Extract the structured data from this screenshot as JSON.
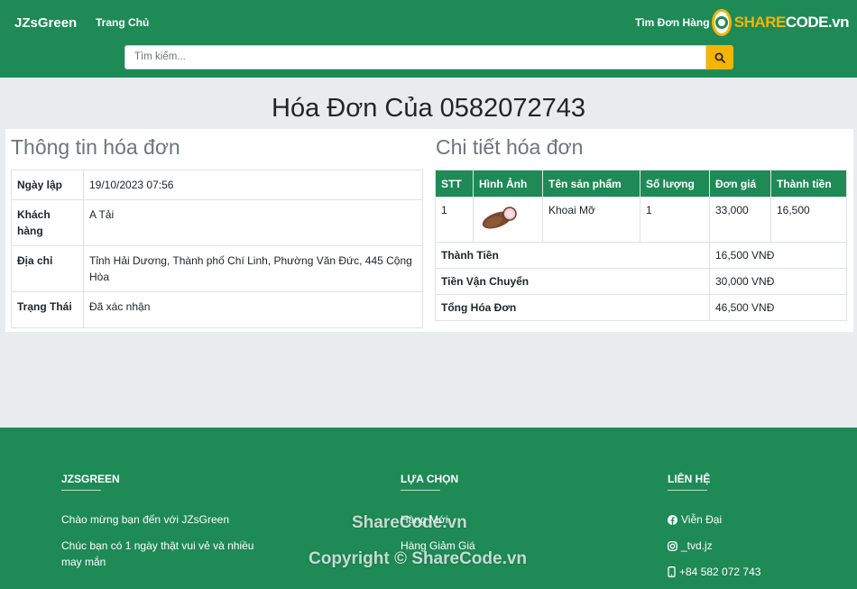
{
  "header": {
    "brand": "JZsGreen",
    "nav_home": "Trang Chủ",
    "nav_orders": "Tìm Đơn Hàng",
    "logo_text_a": "SHARE",
    "logo_text_b": "CODE.vn",
    "search_placeholder": "Tìm kiếm...",
    "search_icon": "search-icon"
  },
  "page": {
    "title": "Hóa Đơn Của 0582072743"
  },
  "invoice_info": {
    "title": "Thông tin hóa đơn",
    "rows": [
      {
        "label": "Ngày lập",
        "value": "19/10/2023 07:56"
      },
      {
        "label": "Khách hàng",
        "value": "A Tải"
      },
      {
        "label": "Địa chỉ",
        "value": "Tỉnh Hải Dương, Thành phố Chí Linh, Phường Văn Đức, 445 Cộng Hòa"
      },
      {
        "label": "Trạng Thái",
        "value": "Đã xác nhận"
      }
    ]
  },
  "invoice_detail": {
    "title": "Chi tiết hóa đơn",
    "columns": [
      "STT",
      "Hình Ảnh",
      "Tên sản phẩm",
      "Số lượng",
      "Đơn giá",
      "Thành tiền"
    ],
    "items": [
      {
        "stt": "1",
        "image": "cassava-image",
        "name": "Khoai Mỡ",
        "qty": "1",
        "price": "33,000",
        "total": "16,500"
      }
    ],
    "summary": [
      {
        "label": "Thành Tiền",
        "value": "16,500 VNĐ"
      },
      {
        "label": "Tiền Vận Chuyển",
        "value": "30,000 VNĐ"
      },
      {
        "label": "Tổng Hóa Đơn",
        "value": "46,500 VNĐ"
      }
    ]
  },
  "footer": {
    "col1_title": "JZSGREEN",
    "col1_text1": "Chào mừng bạn đến với JZsGreen",
    "col1_text2": "Chúc bạn có 1 ngày thật vui vẻ và nhiều may mắn",
    "col2_title": "LỰA CHỌN",
    "col2_link1": "Hàng Mới",
    "col2_link2": "Hàng Giảm Giá",
    "col3_title": "LIÊN HỆ",
    "facebook": "Viễn Đại",
    "instagram": "_tvd.jz",
    "phone": "+84 582 072 743"
  },
  "watermarks": {
    "w1": "ShareCode.vn",
    "w2": "Copyright © ShareCode.vn"
  },
  "colors": {
    "primary_green": "#1e8a56",
    "accent_yellow": "#f5b400",
    "background": "#e9ecef"
  }
}
